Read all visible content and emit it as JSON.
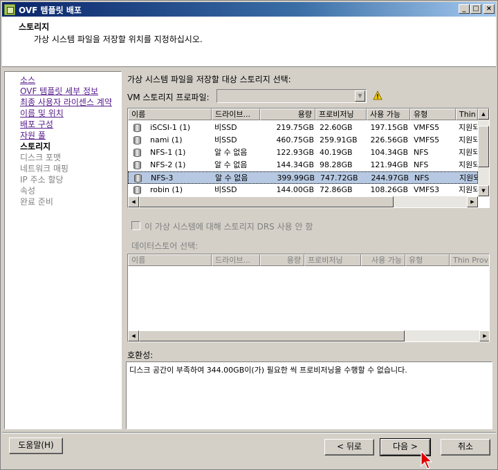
{
  "window": {
    "title": "OVF 템플릿 배포"
  },
  "header": {
    "title": "스토리지",
    "subtitle": "가상 시스템 파일을 저장할 위치를 지정하십시오."
  },
  "nav": {
    "items": [
      {
        "label": "소스",
        "state": "done"
      },
      {
        "label": "OVF 템플릿 세부 정보",
        "state": "done"
      },
      {
        "label": "최종 사용자 라이센스 계약",
        "state": "done"
      },
      {
        "label": "이름 및 위치",
        "state": "done"
      },
      {
        "label": "배포 구성",
        "state": "done"
      },
      {
        "label": "자원 풀",
        "state": "done"
      },
      {
        "label": "스토리지",
        "state": "current"
      },
      {
        "label": "디스크 포맷",
        "state": "future"
      },
      {
        "label": "네트워크 매핑",
        "state": "future"
      },
      {
        "label": "IP 주소 할당",
        "state": "future"
      },
      {
        "label": "속성",
        "state": "future"
      },
      {
        "label": "완료 준비",
        "state": "future"
      }
    ]
  },
  "main": {
    "select_label": "가상 시스템 파일을 저장할 대상 스토리지 선택:",
    "vm_profile_label": "VM 스토리지 프로파일:",
    "vm_profile_value": "",
    "columns": [
      "이름",
      "드라이브...",
      "용량",
      "프로비저닝",
      "사용 가능",
      "유형",
      "Thin P"
    ],
    "rows": [
      {
        "name": "iSCSI-1 (1)",
        "drive": "비SSD",
        "capacity": "219.75GB",
        "provisioned": "22.60GB",
        "free": "197.15GB",
        "type": "VMFS5",
        "thin": "지원되"
      },
      {
        "name": "nami (1)",
        "drive": "비SSD",
        "capacity": "460.75GB",
        "provisioned": "259.91GB",
        "free": "226.56GB",
        "type": "VMFS5",
        "thin": "지원되"
      },
      {
        "name": "NFS-1 (1)",
        "drive": "알 수 없음",
        "capacity": "122.93GB",
        "provisioned": "40.19GB",
        "free": "104.34GB",
        "type": "NFS",
        "thin": "지원되"
      },
      {
        "name": "NFS-2 (1)",
        "drive": "알 수 없음",
        "capacity": "144.34GB",
        "provisioned": "98.28GB",
        "free": "121.94GB",
        "type": "NFS",
        "thin": "지원되"
      },
      {
        "name": "NFS-3",
        "drive": "알 수 없음",
        "capacity": "399.99GB",
        "provisioned": "747.72GB",
        "free": "244.97GB",
        "type": "NFS",
        "thin": "지원되"
      },
      {
        "name": "robin (1)",
        "drive": "비SSD",
        "capacity": "144.00GB",
        "provisioned": "72.86GB",
        "free": "108.26GB",
        "type": "VMFS3",
        "thin": "지원되"
      }
    ],
    "selected_row": 4,
    "drs_checkbox_label": "이 가상 시스템에 대해 스토리지 DRS 사용 안 함",
    "datastore_label": "데이터스토어 선택:",
    "datastore_columns": [
      "이름",
      "드라이브...",
      "용량",
      "프로비저닝",
      "사용 가능",
      "유형",
      "Thin Provis"
    ],
    "compat_label": "호환성:",
    "compat_text": "디스크 공간이 부족하여 344.00GB이(가) 필요한 씩 프로비저닝을 수행할 수 없습니다."
  },
  "buttons": {
    "help": "도움말(H)",
    "back": "< 뒤로",
    "next": "다음 >",
    "cancel": "취소"
  },
  "icons": {
    "app": "ovf-app-icon",
    "warning": "warning-icon",
    "datastore": "datastore-icon",
    "cursor": "mouse-cursor-icon"
  }
}
